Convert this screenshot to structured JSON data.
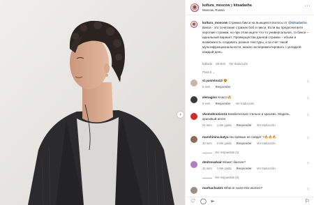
{
  "post": {
    "author": "kultura_moscow",
    "connector": "y",
    "coauthor": "kitsadasha",
    "location": "Moscow, Russia",
    "more_icon": "more-horizontal-icon"
  },
  "caption": {
    "author": "kultura_moscow",
    "text_1": "Стрижка бикси на вьющиеся волосы от",
    "mention": "@kitsadasha",
    "text_2": ". Бикси - это сочетание стрижек боб и пикси. Если вы предпочитаете короткие стрижки, но при этом ищете что-то универсальное, то бикси – идеальный вариант. Преимущества данной стрижки – объем и возможность создавать разные текстуры, а за счет такой мультифункциональности, можно экспериментировать",
    "text_3": "с укладкой каждый день.",
    "edited": "Editado",
    "time": "59 sem",
    "translate": "Ver traducción"
  },
  "sort_label": "Para ti ⌄",
  "comments": [
    {
      "user": "st.yasmina13",
      "text": "😍",
      "time": "5 sem",
      "likes": "",
      "reply": "Responder",
      "translate": "",
      "avatar_color": "#c9b7a5",
      "replies": ""
    },
    {
      "user": "elenagiss",
      "text": "Класс!🔥",
      "time": "6 sem",
      "likes": "",
      "reply": "Responder",
      "translate": "Ver traducción",
      "avatar_color": "#3a3a3a",
      "replies": ""
    },
    {
      "user": "vksmokrasivo11",
      "text": "Бомбическая стильно и красиво. Модель, красивый ангел",
      "time": "21 sem",
      "likes": "1 Me gusta",
      "reply": "Responder",
      "translate": "Ver traducción",
      "avatar_color": "#d12a2a",
      "replies": ""
    },
    {
      "user": "marshinina.katya",
      "text": "На прямые не пойдет ?🔥🔥🔥",
      "time": "42 sem",
      "likes": "2 Me gusta",
      "reply": "Responder",
      "translate": "Ver traducción",
      "avatar_color": "#8a6e5a",
      "replies": "Ver respuestas (1)"
    },
    {
      "user": "dmitrovahair",
      "text": "Может банчен?",
      "time": "41 sem",
      "likes": "1 Me gusta",
      "reply": "Responder",
      "translate": "Ver traducción",
      "avatar_color": "#b07cc6",
      "replies": "Ver respuestas (5)"
    },
    {
      "user": "marhucha321",
      "text": "What is name this women?",
      "time": "",
      "likes": "",
      "reply": "",
      "translate": "",
      "avatar_color": "#9a8f86",
      "replies": ""
    }
  ],
  "actions": {
    "like": "heart-icon",
    "comment": "comment-icon",
    "share": "send-icon",
    "save": "bookmark-icon"
  }
}
